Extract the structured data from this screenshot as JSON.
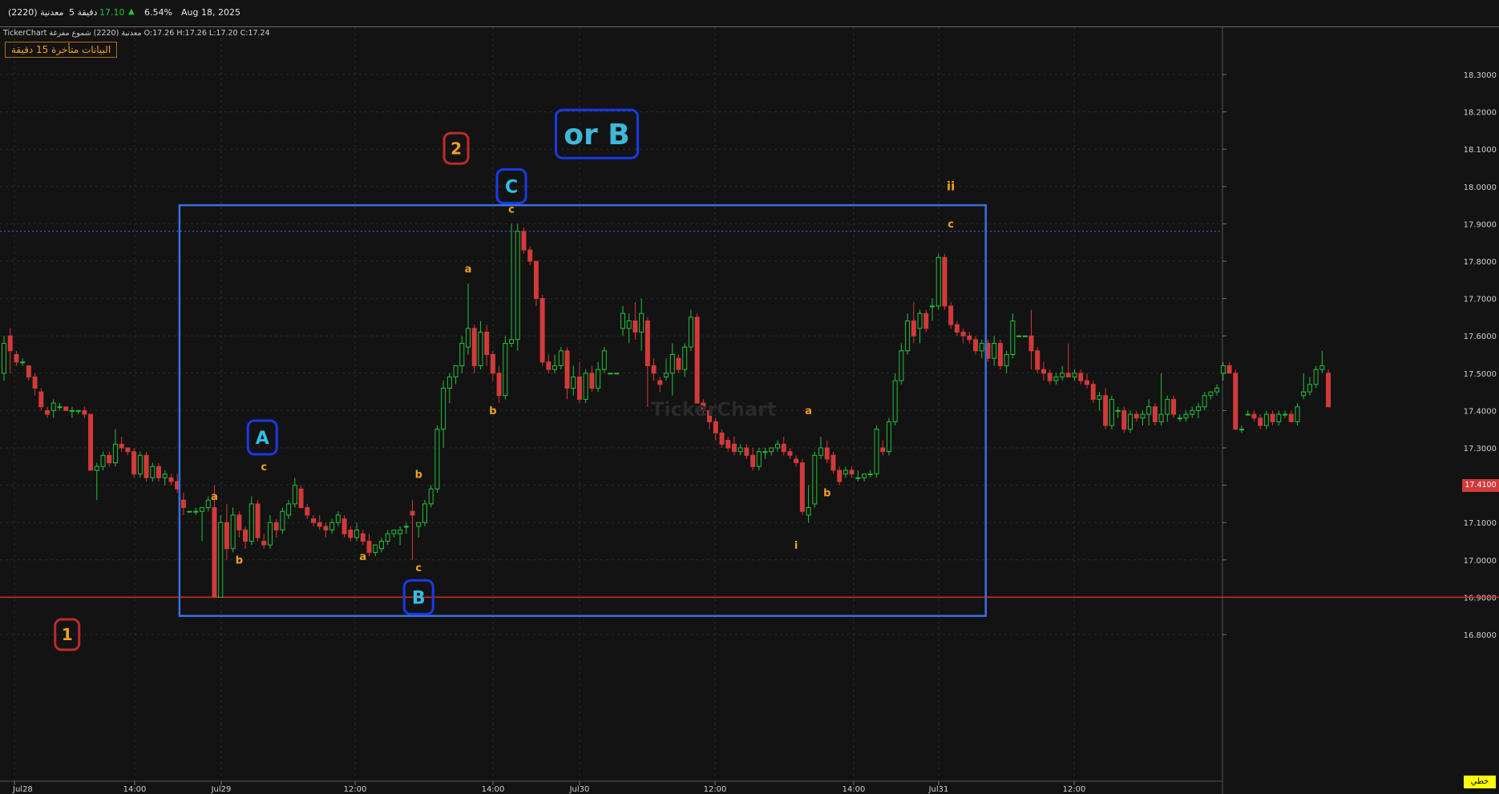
{
  "header": {
    "symbol": "معدنية (2220)",
    "timeframe": "5 دقيقة",
    "last_price": "17.10",
    "change_pct": "6.54%",
    "date": "Aug 18, 2025",
    "ohlc_line": "TickerChart معدنية (2220) شموع مفرغة   O:17.26   H:17.26   L:17.20   C:17.24",
    "delay_notice": "البيانات متأخرة 15 دقيقة"
  },
  "watermark": "TickerChart",
  "price_axis": {
    "ticks": [
      "18.3000",
      "18.2000",
      "18.1000",
      "18.0000",
      "17.9000",
      "17.8000",
      "17.7000",
      "17.6000",
      "17.5000",
      "17.4000",
      "17.3000",
      "17.2000",
      "17.1000",
      "17.0000",
      "16.9000",
      "16.8000"
    ],
    "current_price": "17.4100",
    "scale_button": "خطي"
  },
  "time_axis": {
    "labels": [
      "Jul28",
      "14:00",
      "Jul29",
      "12:00",
      "14:00",
      "Jul30",
      "12:00",
      "14:00",
      "Jul31",
      "12:00"
    ]
  },
  "colors": {
    "up": "#22c23a",
    "down": "#d23a3a",
    "wave_label": "#f0a020",
    "box": "#3b6fe0",
    "support": "#e02a2a"
  },
  "chart_data": {
    "type": "candlestick",
    "title": "",
    "ylim": [
      16.78,
      18.38
    ],
    "support_level": 16.9,
    "resistance_level": 17.88,
    "candles": [
      [
        17.5,
        17.6,
        17.48,
        17.58
      ],
      [
        17.6,
        17.62,
        17.5,
        17.56
      ],
      [
        17.55,
        17.56,
        17.52,
        17.53
      ],
      [
        17.53,
        17.54,
        17.52,
        17.53
      ],
      [
        17.52,
        17.52,
        17.48,
        17.49
      ],
      [
        17.49,
        17.5,
        17.44,
        17.46
      ],
      [
        17.45,
        17.46,
        17.4,
        17.41
      ],
      [
        17.4,
        17.41,
        17.38,
        17.39
      ],
      [
        17.4,
        17.43,
        17.38,
        17.42
      ],
      [
        17.41,
        17.42,
        17.4,
        17.41
      ],
      [
        17.41,
        17.41,
        17.4,
        17.4
      ],
      [
        17.4,
        17.41,
        17.38,
        17.4
      ],
      [
        17.4,
        17.4,
        17.39,
        17.4
      ],
      [
        17.4,
        17.41,
        17.38,
        17.39
      ],
      [
        17.39,
        17.39,
        17.24,
        17.24
      ],
      [
        17.24,
        17.26,
        17.16,
        17.25
      ],
      [
        17.25,
        17.29,
        17.24,
        17.28
      ],
      [
        17.28,
        17.29,
        17.25,
        17.26
      ],
      [
        17.26,
        17.35,
        17.25,
        17.31
      ],
      [
        17.31,
        17.33,
        17.29,
        17.3
      ],
      [
        17.3,
        17.3,
        17.28,
        17.29
      ],
      [
        17.29,
        17.3,
        17.22,
        17.23
      ],
      [
        17.23,
        17.29,
        17.22,
        17.28
      ],
      [
        17.28,
        17.29,
        17.21,
        17.22
      ],
      [
        17.22,
        17.26,
        17.21,
        17.25
      ],
      [
        17.25,
        17.26,
        17.21,
        17.22
      ],
      [
        17.22,
        17.24,
        17.2,
        17.23
      ],
      [
        17.22,
        17.23,
        17.2,
        17.21
      ],
      [
        17.21,
        17.23,
        17.18,
        17.19
      ],
      [
        17.16,
        17.18,
        17.12,
        17.14
      ],
      [
        17.13,
        17.13,
        17.13,
        17.13
      ],
      [
        17.13,
        17.14,
        17.12,
        17.13
      ],
      [
        17.13,
        17.14,
        17.05,
        17.14
      ],
      [
        17.14,
        17.17,
        17.13,
        17.16
      ],
      [
        17.14,
        17.2,
        16.9,
        16.9
      ],
      [
        16.9,
        17.12,
        16.9,
        17.1
      ],
      [
        17.1,
        17.15,
        17.0,
        17.03
      ],
      [
        17.03,
        17.14,
        17.02,
        17.12
      ],
      [
        17.12,
        17.13,
        17.06,
        17.08
      ],
      [
        17.08,
        17.09,
        17.03,
        17.05
      ],
      [
        17.05,
        17.17,
        17.04,
        17.15
      ],
      [
        17.15,
        17.16,
        17.05,
        17.06
      ],
      [
        17.05,
        17.07,
        17.03,
        17.04
      ],
      [
        17.04,
        17.12,
        17.03,
        17.1
      ],
      [
        17.1,
        17.11,
        17.06,
        17.08
      ],
      [
        17.08,
        17.14,
        17.07,
        17.13
      ],
      [
        17.12,
        17.16,
        17.11,
        17.15
      ],
      [
        17.15,
        17.22,
        17.14,
        17.2
      ],
      [
        17.19,
        17.2,
        17.14,
        17.14
      ],
      [
        17.14,
        17.15,
        17.11,
        17.12
      ],
      [
        17.11,
        17.12,
        17.09,
        17.1
      ],
      [
        17.1,
        17.12,
        17.08,
        17.09
      ],
      [
        17.09,
        17.1,
        17.06,
        17.08
      ],
      [
        17.08,
        17.11,
        17.07,
        17.1
      ],
      [
        17.1,
        17.13,
        17.09,
        17.12
      ],
      [
        17.11,
        17.12,
        17.06,
        17.07
      ],
      [
        17.08,
        17.09,
        17.05,
        17.06
      ],
      [
        17.06,
        17.1,
        17.05,
        17.08
      ],
      [
        17.07,
        17.08,
        17.04,
        17.05
      ],
      [
        17.05,
        17.07,
        17.01,
        17.02
      ],
      [
        17.02,
        17.04,
        17.01,
        17.04
      ],
      [
        17.03,
        17.06,
        17.02,
        17.05
      ],
      [
        17.05,
        17.08,
        17.04,
        17.07
      ],
      [
        17.07,
        17.08,
        17.06,
        17.08
      ],
      [
        17.07,
        17.09,
        17.04,
        17.08
      ],
      [
        17.09,
        17.1,
        17.07,
        17.09
      ],
      [
        17.13,
        17.16,
        17.0,
        17.12
      ],
      [
        17.09,
        17.09,
        17.06,
        17.1
      ],
      [
        17.1,
        17.16,
        17.09,
        17.15
      ],
      [
        17.15,
        17.2,
        17.14,
        17.19
      ],
      [
        17.19,
        17.36,
        17.18,
        17.35
      ],
      [
        17.35,
        17.48,
        17.3,
        17.46
      ],
      [
        17.46,
        17.5,
        17.42,
        17.49
      ],
      [
        17.49,
        17.52,
        17.47,
        17.52
      ],
      [
        17.52,
        17.6,
        17.5,
        17.58
      ],
      [
        17.57,
        17.74,
        17.55,
        17.62
      ],
      [
        17.62,
        17.63,
        17.5,
        17.52
      ],
      [
        17.52,
        17.64,
        17.51,
        17.61
      ],
      [
        17.61,
        17.63,
        17.52,
        17.55
      ],
      [
        17.55,
        17.56,
        17.48,
        17.5
      ],
      [
        17.5,
        17.52,
        17.42,
        17.44
      ],
      [
        17.44,
        17.6,
        17.43,
        17.58
      ],
      [
        17.58,
        17.9,
        17.57,
        17.59
      ],
      [
        17.59,
        17.9,
        17.56,
        17.88
      ],
      [
        17.88,
        17.89,
        17.82,
        17.83
      ],
      [
        17.83,
        17.84,
        17.79,
        17.8
      ],
      [
        17.8,
        17.8,
        17.68,
        17.7
      ],
      [
        17.7,
        17.71,
        17.52,
        17.53
      ],
      [
        17.53,
        17.55,
        17.5,
        17.51
      ],
      [
        17.51,
        17.55,
        17.5,
        17.52
      ],
      [
        17.52,
        17.57,
        17.51,
        17.56
      ],
      [
        17.56,
        17.57,
        17.43,
        17.46
      ],
      [
        17.46,
        17.52,
        17.44,
        17.49
      ],
      [
        17.49,
        17.53,
        17.42,
        17.43
      ],
      [
        17.43,
        17.51,
        17.42,
        17.5
      ],
      [
        17.5,
        17.52,
        17.45,
        17.46
      ],
      [
        17.46,
        17.53,
        17.45,
        17.51
      ],
      [
        17.51,
        17.57,
        17.5,
        17.56
      ],
      [
        17.5,
        17.5,
        17.5,
        17.5
      ],
      [
        17.5,
        17.5,
        17.5,
        17.5
      ],
      [
        17.62,
        17.68,
        17.6,
        17.66
      ],
      [
        17.62,
        17.66,
        17.58,
        17.64
      ],
      [
        17.64,
        17.69,
        17.59,
        17.61
      ],
      [
        17.61,
        17.7,
        17.56,
        17.66
      ],
      [
        17.64,
        17.65,
        17.41,
        17.52
      ],
      [
        17.52,
        17.54,
        17.48,
        17.5
      ],
      [
        17.48,
        17.49,
        17.45,
        17.47
      ],
      [
        17.49,
        17.54,
        17.48,
        17.5
      ],
      [
        17.5,
        17.58,
        17.44,
        17.55
      ],
      [
        17.54,
        17.55,
        17.5,
        17.51
      ],
      [
        17.51,
        17.58,
        17.49,
        17.57
      ],
      [
        17.57,
        17.67,
        17.56,
        17.65
      ],
      [
        17.65,
        17.66,
        17.42,
        17.42
      ],
      [
        17.42,
        17.43,
        17.39,
        17.4
      ],
      [
        17.4,
        17.41,
        17.35,
        17.37
      ],
      [
        17.37,
        17.38,
        17.32,
        17.34
      ],
      [
        17.34,
        17.35,
        17.3,
        17.31
      ],
      [
        17.32,
        17.33,
        17.29,
        17.3
      ],
      [
        17.31,
        17.33,
        17.28,
        17.29
      ],
      [
        17.29,
        17.31,
        17.28,
        17.3
      ],
      [
        17.3,
        17.31,
        17.27,
        17.28
      ],
      [
        17.28,
        17.3,
        17.24,
        17.25
      ],
      [
        17.25,
        17.3,
        17.24,
        17.29
      ],
      [
        17.29,
        17.3,
        17.27,
        17.29
      ],
      [
        17.29,
        17.3,
        17.28,
        17.3
      ],
      [
        17.3,
        17.32,
        17.29,
        17.31
      ],
      [
        17.31,
        17.33,
        17.28,
        17.29
      ],
      [
        17.29,
        17.3,
        17.27,
        17.28
      ],
      [
        17.27,
        17.28,
        17.25,
        17.26
      ],
      [
        17.26,
        17.27,
        17.12,
        17.13
      ],
      [
        17.12,
        17.2,
        17.1,
        17.14
      ],
      [
        17.15,
        17.29,
        17.14,
        17.28
      ],
      [
        17.28,
        17.33,
        17.27,
        17.3
      ],
      [
        17.3,
        17.32,
        17.26,
        17.27
      ],
      [
        17.28,
        17.29,
        17.23,
        17.24
      ],
      [
        17.24,
        17.25,
        17.2,
        17.21
      ],
      [
        17.23,
        17.25,
        17.22,
        17.24
      ],
      [
        17.24,
        17.25,
        17.22,
        17.23
      ],
      [
        17.22,
        17.24,
        17.21,
        17.22
      ],
      [
        17.22,
        17.23,
        17.21,
        17.23
      ],
      [
        17.23,
        17.24,
        17.22,
        17.23
      ],
      [
        17.23,
        17.36,
        17.22,
        17.35
      ],
      [
        17.3,
        17.32,
        17.28,
        17.29
      ],
      [
        17.29,
        17.38,
        17.28,
        17.37
      ],
      [
        17.37,
        17.5,
        17.36,
        17.48
      ],
      [
        17.48,
        17.58,
        17.47,
        17.56
      ],
      [
        17.56,
        17.66,
        17.55,
        17.64
      ],
      [
        17.64,
        17.69,
        17.58,
        17.6
      ],
      [
        17.62,
        17.67,
        17.58,
        17.66
      ],
      [
        17.66,
        17.67,
        17.61,
        17.62
      ],
      [
        17.68,
        17.7,
        17.64,
        17.68
      ],
      [
        17.68,
        17.82,
        17.67,
        17.81
      ],
      [
        17.81,
        17.82,
        17.67,
        17.68
      ],
      [
        17.68,
        17.69,
        17.62,
        17.63
      ],
      [
        17.63,
        17.64,
        17.6,
        17.61
      ],
      [
        17.61,
        17.62,
        17.58,
        17.6
      ],
      [
        17.6,
        17.61,
        17.58,
        17.59
      ],
      [
        17.59,
        17.6,
        17.55,
        17.56
      ],
      [
        17.56,
        17.59,
        17.54,
        17.58
      ],
      [
        17.58,
        17.59,
        17.53,
        17.54
      ],
      [
        17.54,
        17.6,
        17.52,
        17.58
      ],
      [
        17.58,
        17.59,
        17.51,
        17.52
      ],
      [
        17.52,
        17.56,
        17.5,
        17.55
      ],
      [
        17.55,
        17.66,
        17.54,
        17.64
      ],
      [
        17.6,
        17.6,
        17.6,
        17.6
      ],
      [
        17.6,
        17.6,
        17.6,
        17.6
      ],
      [
        17.6,
        17.67,
        17.51,
        17.56
      ],
      [
        17.56,
        17.57,
        17.5,
        17.51
      ],
      [
        17.51,
        17.53,
        17.48,
        17.5
      ],
      [
        17.5,
        17.51,
        17.47,
        17.48
      ],
      [
        17.48,
        17.5,
        17.47,
        17.49
      ],
      [
        17.49,
        17.52,
        17.48,
        17.5
      ],
      [
        17.5,
        17.58,
        17.49,
        17.49
      ],
      [
        17.49,
        17.51,
        17.48,
        17.5
      ],
      [
        17.5,
        17.51,
        17.47,
        17.48
      ],
      [
        17.48,
        17.5,
        17.46,
        17.47
      ],
      [
        17.47,
        17.48,
        17.42,
        17.43
      ],
      [
        17.43,
        17.45,
        17.4,
        17.44
      ],
      [
        17.44,
        17.46,
        17.35,
        17.36
      ],
      [
        17.36,
        17.44,
        17.35,
        17.43
      ],
      [
        17.4,
        17.41,
        17.38,
        17.4
      ],
      [
        17.4,
        17.41,
        17.34,
        17.35
      ],
      [
        17.35,
        17.4,
        17.34,
        17.39
      ],
      [
        17.39,
        17.4,
        17.37,
        17.38
      ],
      [
        17.38,
        17.4,
        17.36,
        17.39
      ],
      [
        17.39,
        17.43,
        17.36,
        17.41
      ],
      [
        17.41,
        17.42,
        17.36,
        17.37
      ],
      [
        17.37,
        17.5,
        17.36,
        17.39
      ],
      [
        17.39,
        17.44,
        17.37,
        17.43
      ],
      [
        17.43,
        17.44,
        17.38,
        17.39
      ],
      [
        17.38,
        17.39,
        17.37,
        17.38
      ],
      [
        17.38,
        17.4,
        17.37,
        17.39
      ],
      [
        17.39,
        17.41,
        17.38,
        17.4
      ],
      [
        17.4,
        17.42,
        17.38,
        17.41
      ],
      [
        17.41,
        17.45,
        17.4,
        17.44
      ],
      [
        17.44,
        17.45,
        17.43,
        17.45
      ],
      [
        17.45,
        17.47,
        17.44,
        17.46
      ],
      [
        17.5,
        17.53,
        17.48,
        17.52
      ],
      [
        17.52,
        17.53,
        17.5,
        17.5
      ],
      [
        17.5,
        17.51,
        17.35,
        17.35
      ],
      [
        17.35,
        17.36,
        17.34,
        17.35
      ],
      [
        17.39,
        17.4,
        17.39,
        17.39
      ],
      [
        17.39,
        17.4,
        17.37,
        17.38
      ],
      [
        17.38,
        17.39,
        17.35,
        17.36
      ],
      [
        17.36,
        17.4,
        17.35,
        17.39
      ],
      [
        17.39,
        17.4,
        17.36,
        17.37
      ],
      [
        17.37,
        17.4,
        17.36,
        17.39
      ],
      [
        17.39,
        17.4,
        17.38,
        17.39
      ],
      [
        17.39,
        17.4,
        17.37,
        17.37
      ],
      [
        17.37,
        17.42,
        17.36,
        17.41
      ],
      [
        17.44,
        17.5,
        17.43,
        17.45
      ],
      [
        17.45,
        17.49,
        17.44,
        17.47
      ],
      [
        17.47,
        17.52,
        17.46,
        17.51
      ],
      [
        17.51,
        17.56,
        17.5,
        17.52
      ],
      [
        17.5,
        17.51,
        17.41,
        17.41
      ]
    ],
    "annotations": {
      "wave_labels": [
        {
          "text": "a",
          "bar": 34,
          "price": 17.16
        },
        {
          "text": "b",
          "bar": 38,
          "price": 16.99
        },
        {
          "text": "c",
          "bar": 42,
          "price": 17.24
        },
        {
          "text": "a",
          "bar": 58,
          "price": 17.0
        },
        {
          "text": "b",
          "bar": 67,
          "price": 17.22
        },
        {
          "text": "c",
          "bar": 67,
          "price": 16.97
        },
        {
          "text": "a",
          "bar": 75,
          "price": 17.77
        },
        {
          "text": "b",
          "bar": 79,
          "price": 17.39
        },
        {
          "text": "c",
          "bar": 82,
          "price": 17.93
        },
        {
          "text": "a",
          "bar": 130,
          "price": 17.39
        },
        {
          "text": "b",
          "bar": 133,
          "price": 17.17
        },
        {
          "text": "i",
          "bar": 128,
          "price": 17.03
        },
        {
          "text": "c",
          "bar": 153,
          "price": 17.89
        },
        {
          "text": "ii",
          "bar": 153,
          "price": 17.99
        }
      ],
      "boxed_labels": [
        {
          "text": "A",
          "bar": 42,
          "price": 17.3,
          "style": "blue"
        },
        {
          "text": "B",
          "bar": 67,
          "price": 16.9,
          "style": "blue"
        },
        {
          "text": "C",
          "bar": 82,
          "price": 17.99,
          "style": "blue"
        },
        {
          "text": "or B",
          "bar": 91,
          "price": 18.1,
          "style": "blue-large"
        },
        {
          "text": "2",
          "bar": 82,
          "price": 18.1,
          "style": "red"
        },
        {
          "text": "1",
          "bar": 8,
          "price": 16.8,
          "style": "red"
        }
      ],
      "rectangle": {
        "from_bar": 29,
        "to_bar": 158,
        "top": 17.95,
        "bottom": 16.85
      }
    }
  }
}
